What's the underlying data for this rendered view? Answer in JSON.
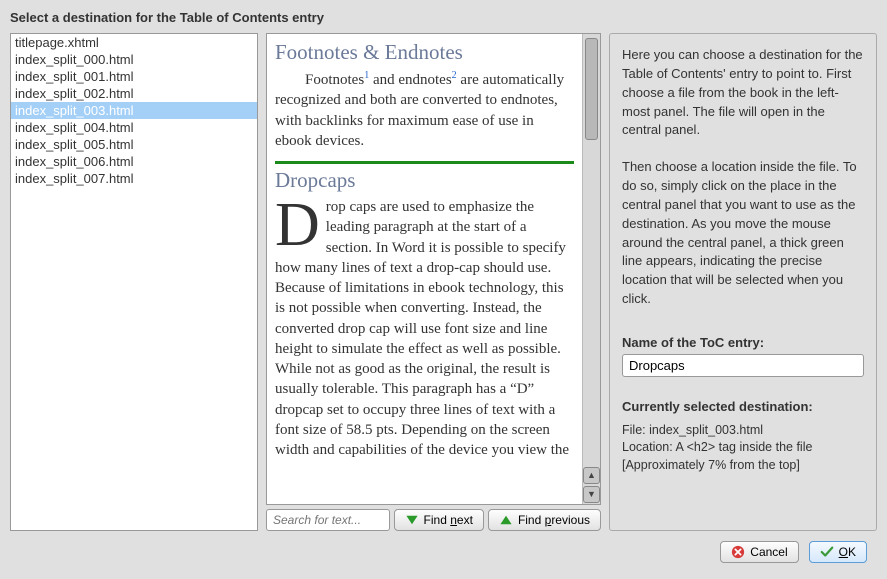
{
  "title": "Select a destination for the Table of Contents entry",
  "files": [
    "titlepage.xhtml",
    "index_split_000.html",
    "index_split_001.html",
    "index_split_002.html",
    "index_split_003.html",
    "index_split_004.html",
    "index_split_005.html",
    "index_split_006.html",
    "index_split_007.html"
  ],
  "selected_file_index": 4,
  "preview": {
    "h1": "Footnotes & Endnotes",
    "p1a": "Footnotes",
    "p1b": " and endnotes",
    "p1c": " are automatically recognized and both are converted to endnotes, with backlinks for maximum ease of use in ebook devices.",
    "sup1": "1",
    "sup2": "2",
    "h2": "Dropcaps",
    "drop": "D",
    "p2": "rop caps are used to emphasize the leading paragraph at the start of a section. In Word it is possible to specify how many lines of text a drop-cap should use. Because of limitations in ebook technology, this is not possible when converting. Instead, the converted drop cap will use font size and line height to simulate the effect as well as possible. While not as good as the original, the result is usually tolerable. This paragraph has a “D” dropcap set to occupy three lines of text with a font size of 58.5 pts. Depending on the screen width and capabilities of the device you view the"
  },
  "search": {
    "placeholder": "Search for text..."
  },
  "find_next": "Find ",
  "find_next_u": "n",
  "find_next_after": "ext",
  "find_prev": "Find ",
  "find_prev_u": "p",
  "find_prev_after": "revious",
  "help": {
    "p1": "Here you can choose a destination for the Table of Contents' entry to point to. First choose a file from the book in the left-most panel. The file will open in the central panel.",
    "p2": "Then choose a location inside the file. To do so, simply click on the place in the central panel that you want to use as the destination. As you move the mouse around the central panel, a thick green line appears, indicating the precise location that will be selected when you click."
  },
  "name_label": "Name of the ToC entry:",
  "name_value": "Dropcaps",
  "dest_label": "Currently selected destination:",
  "dest_file": "File: index_split_003.html",
  "dest_loc": "Location: A <h2> tag inside the file",
  "dest_approx": "[Approximately 7% from the top]",
  "cancel": "Cancel",
  "ok": "OK",
  "ok_u": "O",
  "ok_after": "K"
}
